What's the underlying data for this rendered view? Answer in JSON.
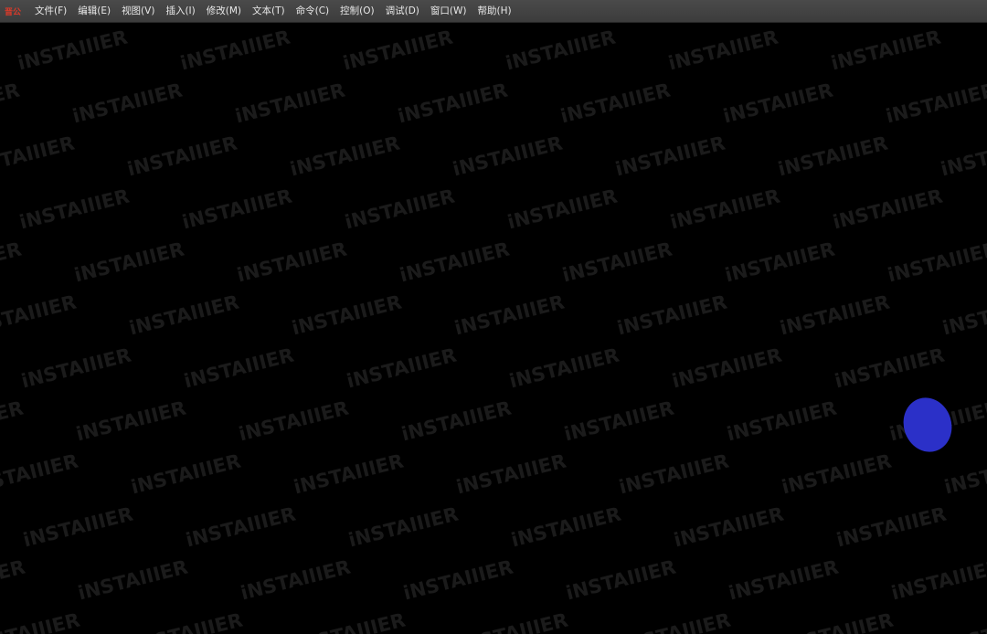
{
  "menubar": {
    "logo_text": "晋公",
    "items": [
      {
        "label": "文件(F)"
      },
      {
        "label": "编辑(E)"
      },
      {
        "label": "视图(V)"
      },
      {
        "label": "插入(I)"
      },
      {
        "label": "修改(M)"
      },
      {
        "label": "文本(T)"
      },
      {
        "label": "命令(C)"
      },
      {
        "label": "控制(O)"
      },
      {
        "label": "调试(D)"
      },
      {
        "label": "窗口(W)"
      },
      {
        "label": "帮助(H)"
      }
    ]
  },
  "canvas": {
    "watermark_text": "iNSTAIIIER",
    "background_color": "#000000",
    "blob_color": "#2b30c8"
  }
}
